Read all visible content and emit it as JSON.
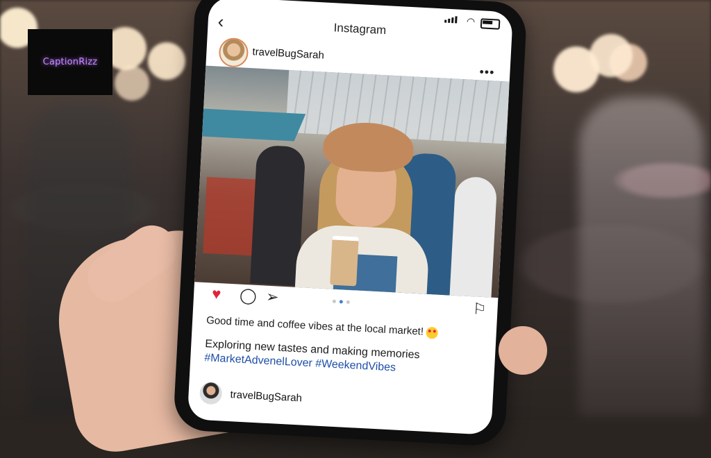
{
  "logo": {
    "text": "CaptionRizz"
  },
  "app": {
    "title": "Instagram",
    "back_icon": "chevron-left-icon"
  },
  "post": {
    "username": "travelBugSarah",
    "more_label": "•••",
    "actions": {
      "like_icon": "heart-icon",
      "comment_icon": "comment-icon",
      "share_icon": "send-icon",
      "save_icon": "bookmark-icon"
    },
    "carousel": {
      "count": 3,
      "active": 2
    },
    "caption_line1": "Good time and coffee vibes at the local market!",
    "caption_line2": "Exploring new tastes and making memories",
    "hashtags": "#MarketAdvenelLover #WeekendVibes",
    "footer_username": "travelBugSarah"
  },
  "colors": {
    "like": "#e0243a",
    "hashtag": "#1f4fa8",
    "carousel_active": "#3b82d6"
  }
}
